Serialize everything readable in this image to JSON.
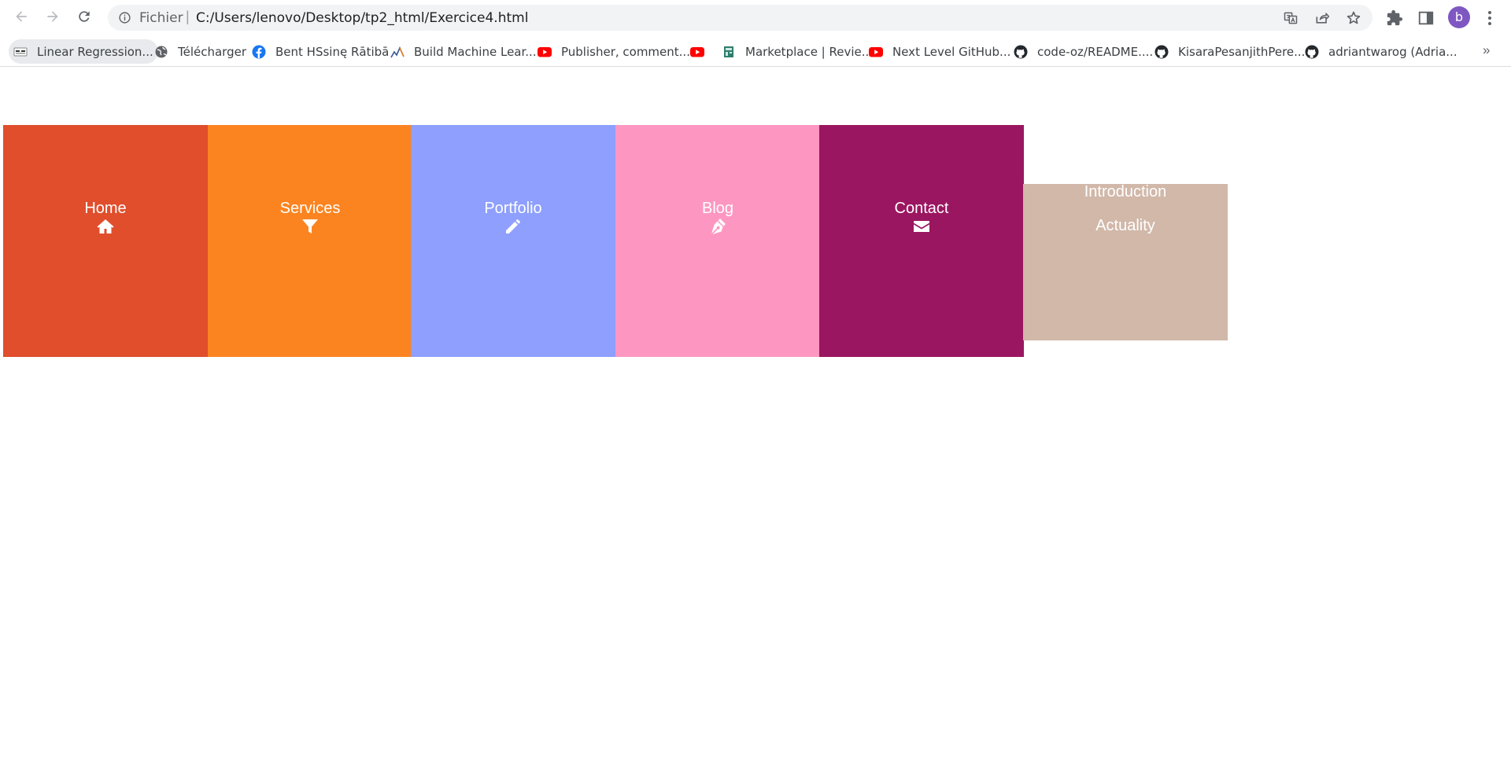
{
  "browser": {
    "address_bar": {
      "scheme_label": "Fichier",
      "url": "C:/Users/lenovo/Desktop/tp2_html/Exercice4.html"
    },
    "profile_initial": "b",
    "icons": [
      "back-icon",
      "forward-icon",
      "reload-icon",
      "info-icon",
      "translate-icon",
      "share-icon",
      "star-icon",
      "extensions-icon",
      "side-panel-icon",
      "menu-icon"
    ]
  },
  "bookmarks": [
    {
      "label": "Linear Regression...",
      "icon": "dataset-favicon"
    },
    {
      "label": "Télécharger",
      "icon": "globe-favicon"
    },
    {
      "label": "Bent HSsinę Rātibā",
      "icon": "facebook-favicon"
    },
    {
      "label": "Build Machine Lear...",
      "icon": "chart-favicon"
    },
    {
      "label": "Publisher, comment...",
      "icon": "youtube-favicon"
    },
    {
      "label": "",
      "icon": "youtube-favicon"
    },
    {
      "label": "Marketplace | Revie...",
      "icon": "marketplace-favicon"
    },
    {
      "label": "Next Level GitHub...",
      "icon": "youtube-favicon"
    },
    {
      "label": "code-oz/README....",
      "icon": "github-favicon"
    },
    {
      "label": "KisaraPesanjithPere...",
      "icon": "github-favicon"
    },
    {
      "label": "adriantwarog (Adria...",
      "icon": "github-favicon"
    }
  ],
  "bookmarks_overflow": "»",
  "menu": {
    "items": [
      {
        "label": "Home",
        "icon": "home-icon",
        "color": "#e04e2c"
      },
      {
        "label": "Services",
        "icon": "filter-icon",
        "color": "#fc8420"
      },
      {
        "label": "Portfolio",
        "icon": "pencil-icon",
        "color": "#8e9ffd"
      },
      {
        "label": "Blog",
        "icon": "pen-nib-icon",
        "color": "#fd97c1"
      },
      {
        "label": "Contact",
        "icon": "envelope-icon",
        "color": "#9b1660"
      }
    ],
    "submenu": {
      "items": [
        "Introduction",
        "Actuality"
      ],
      "color": "#d1b8a9"
    }
  }
}
